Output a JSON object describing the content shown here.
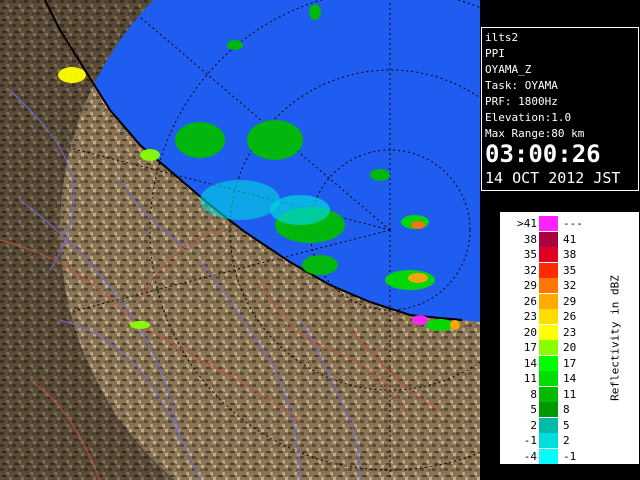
{
  "radar": {
    "station": "ilts2",
    "mode": "PPI",
    "product": "OYAMA_Z",
    "task": "Task: OYAMA",
    "prf": "PRF: 1800Hz",
    "elevation": "Elevation:1.0",
    "max_range": "Max Range:80 km",
    "time": "03:00:26",
    "date": "14 OCT 2012 JST"
  },
  "legend": {
    "unit_label": "Reflectivity in dBZ",
    "rows": [
      {
        "lo": ">41",
        "hi": "---",
        "color": "#ff22ff"
      },
      {
        "lo": "38",
        "hi": "41",
        "color": "#aa0040"
      },
      {
        "lo": "35",
        "hi": "38",
        "color": "#dd0022"
      },
      {
        "lo": "32",
        "hi": "35",
        "color": "#ff2a00"
      },
      {
        "lo": "29",
        "hi": "32",
        "color": "#ff7700"
      },
      {
        "lo": "26",
        "hi": "29",
        "color": "#ffaa00"
      },
      {
        "lo": "23",
        "hi": "26",
        "color": "#ffdd00"
      },
      {
        "lo": "20",
        "hi": "23",
        "color": "#ffff00"
      },
      {
        "lo": "17",
        "hi": "20",
        "color": "#88ff00"
      },
      {
        "lo": "14",
        "hi": "17",
        "color": "#00ff00"
      },
      {
        "lo": "11",
        "hi": "14",
        "color": "#00dd00"
      },
      {
        "lo": "8",
        "hi": "11",
        "color": "#00bb00"
      },
      {
        "lo": "5",
        "hi": "8",
        "color": "#009900"
      },
      {
        "lo": "2",
        "hi": "5",
        "color": "#00bbaa"
      },
      {
        "lo": "-1",
        "hi": "2",
        "color": "#00dddd"
      },
      {
        "lo": "-4",
        "hi": "-1",
        "color": "#00ffff"
      }
    ]
  },
  "colors": {
    "sea": "#1f5cf0",
    "land": "#8a7456",
    "range_ring": "#000000"
  }
}
